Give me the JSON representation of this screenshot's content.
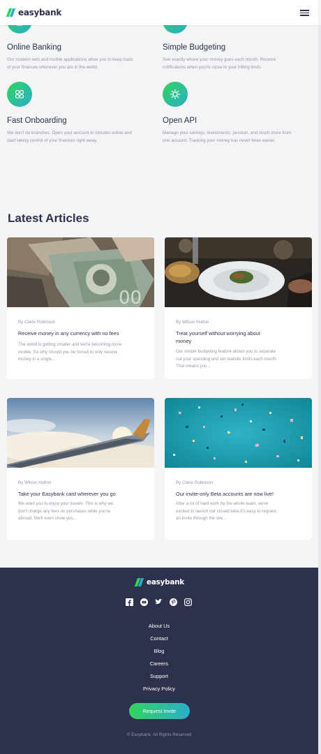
{
  "header": {
    "brand": "easybank",
    "menu_icon": "hamburger-menu-icon"
  },
  "colors": {
    "navy": "#2d314d",
    "green": "#33d35e",
    "cyan": "#2aaec9",
    "grey_text": "#9597a7",
    "light_bg": "#f4f5f7"
  },
  "features": [
    {
      "icon": "online-banking-icon",
      "title": "Online Banking",
      "lines": [
        "Our modern web and mobile applications allow you to keep track",
        "of your finances wherever you are in the world."
      ]
    },
    {
      "icon": "budgeting-icon",
      "title": "Simple Budgeting",
      "lines": [
        "See exactly where your money goes each month. Receive",
        "notifications when you're close to your hitting limits"
      ]
    },
    {
      "icon": "onboarding-icon",
      "title": "Fast Onboarding",
      "lines": [
        "We don't do branches. Open your account in minutes online and",
        "start taking control of your finances right away."
      ]
    },
    {
      "icon": "api-icon",
      "title": "Open API",
      "lines": [
        "Manage your savings, investments, pension, and much more from",
        "one account. Tracking your money has never been easier."
      ]
    }
  ],
  "articles": {
    "title": "Latest Articles",
    "items": [
      {
        "author": "By Claire Robinson",
        "title": "Receive money in any currency with no fees",
        "lines": [
          "The world is getting smaller and we're becoming more",
          "mobile. So why should you be forced to only receive",
          "money in a single..."
        ]
      },
      {
        "author": "By Wilson Hutton",
        "title_lines": [
          "Treat yourself without worrying about",
          "money"
        ],
        "lines": [
          "Our simple budgeting feature allows you to separate",
          "out your spending and set realistic limits each month.",
          "That means you..."
        ]
      },
      {
        "author": "By Wilson Hutton",
        "title": "Take your Easybank card wherever you go",
        "lines": [
          "We want you to enjoy your travels. This is why we",
          "don't charge any fees on purchases while you're",
          "abroad. We'll even show you..."
        ]
      },
      {
        "author": "By Claire Robinson",
        "title": "Our invite-only Beta accounts are now live!",
        "lines": [
          "After a lot of hard work by the whole team, we're",
          "excited to launch our closed beta.It's easy to request",
          "an invite through the site..."
        ]
      }
    ]
  },
  "footer": {
    "brand": "easybank",
    "socials": [
      "facebook-icon",
      "youtube-icon",
      "twitter-icon",
      "pinterest-icon",
      "instagram-icon"
    ],
    "links": [
      "About Us",
      "Contact",
      "Blog",
      "Careers",
      "Support",
      "Privacy Policy"
    ],
    "cta": "Request Invite",
    "copyright": "© Easybank. All Rights Reserved"
  }
}
